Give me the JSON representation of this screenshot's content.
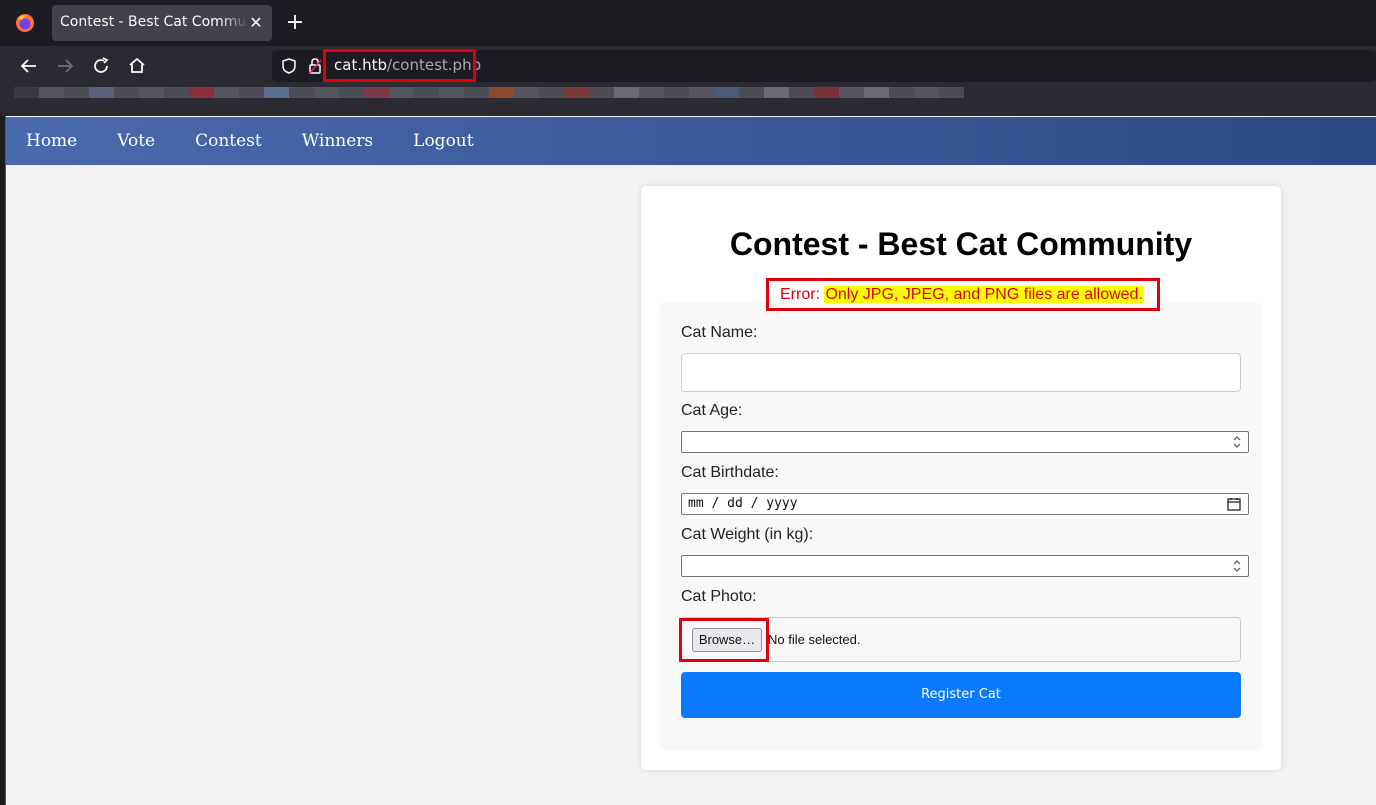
{
  "browser": {
    "tab_title": "Contest - Best Cat Community",
    "tab_close": "✕",
    "new_tab": "+",
    "url_host": "cat.htb",
    "url_path": "/contest.php"
  },
  "site_nav": {
    "items": [
      "Home",
      "Vote",
      "Contest",
      "Winners",
      "Logout"
    ]
  },
  "page": {
    "title": "Contest - Best Cat Community",
    "error_prefix": "Error: ",
    "error_message": "Only JPG, JPEG, and PNG files are allowed."
  },
  "form": {
    "cat_name_label": "Cat Name:",
    "cat_name_value": "",
    "cat_age_label": "Cat Age:",
    "cat_age_value": "",
    "cat_birthdate_label": "Cat Birthdate:",
    "cat_birthdate_placeholder": "mm / dd / yyyy",
    "cat_weight_label": "Cat Weight (in kg):",
    "cat_weight_value": "",
    "cat_photo_label": "Cat Photo:",
    "browse_label": "Browse…",
    "no_file_text": "No file selected.",
    "submit_label": "Register Cat"
  },
  "colors": {
    "highlight_box": "#e0000b",
    "error_highlight": "#ffff00",
    "submit_button": "#0a7aff",
    "site_nav_start": "#4a6aae",
    "site_nav_end": "#2a4a86"
  }
}
